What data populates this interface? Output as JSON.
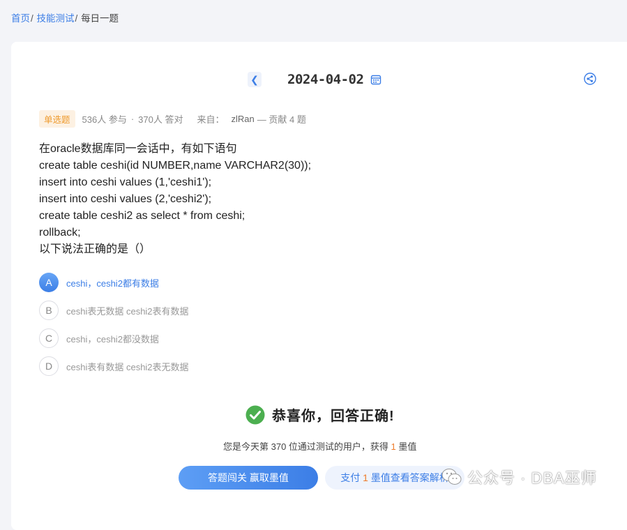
{
  "breadcrumb": {
    "home": "首页",
    "sep1": "/",
    "skills": "技能测试",
    "sep2": "/",
    "current": "每日一题"
  },
  "date_nav": {
    "prev_icon": "chevron-left-icon",
    "date": "2024-04-02",
    "calendar_icon": "calendar-icon"
  },
  "share_icon": "share-icon",
  "meta": {
    "type_tag": "单选题",
    "participants": "536人 参与",
    "dot": "·",
    "correct": "370人 答对",
    "from_label": "来自：",
    "author": "zlRan",
    "contribution": "— 贡献 4 题"
  },
  "question": {
    "lines": [
      "在oracle数据库同一会话中，有如下语句",
      "create table ceshi(id NUMBER,name VARCHAR2(30));",
      "insert into ceshi values (1,'ceshi1');",
      "insert into ceshi values (2,'ceshi2');",
      "create table ceshi2 as select * from ceshi;",
      "rollback;",
      "以下说法正确的是（）"
    ]
  },
  "options": [
    {
      "letter": "A",
      "text": "ceshi，ceshi2都有数据",
      "selected": true
    },
    {
      "letter": "B",
      "text": "ceshi表无数据 ceshi2表有数据",
      "selected": false
    },
    {
      "letter": "C",
      "text": "ceshi，ceshi2都没数据",
      "selected": false
    },
    {
      "letter": "D",
      "text": "ceshi表有数据 ceshi2表无数据",
      "selected": false
    }
  ],
  "result": {
    "icon": "check-circle-icon",
    "message": "恭喜你，回答正确!",
    "info_prefix": "您是今天第 370 位通过测试的用户，获得 ",
    "info_points": "1",
    "info_suffix": " 墨值"
  },
  "buttons": {
    "primary": "答题闯关 赢取墨值",
    "secondary_prefix": "支付 ",
    "secondary_points": "1",
    "secondary_suffix": " 墨值查看答案解析"
  },
  "watermark": {
    "icon": "wechat-icon",
    "text": "公众号 · DBA巫师"
  },
  "colors": {
    "accent": "#3c7ee6",
    "tag_bg": "#fdf1e2",
    "tag_text": "#ee9a2d",
    "success": "#4caf50",
    "points": "#ee7a28"
  }
}
